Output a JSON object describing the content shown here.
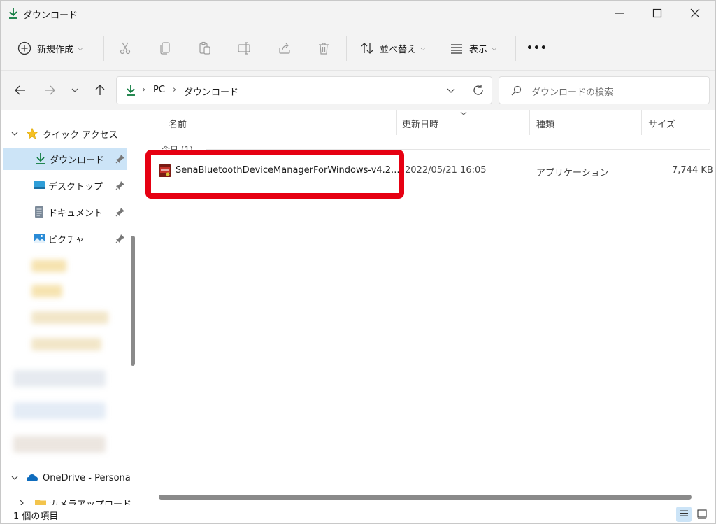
{
  "window": {
    "title": "ダウンロード"
  },
  "toolbar": {
    "new_label": "新規作成",
    "sort_label": "並べ替え",
    "view_label": "表示",
    "more_label": "•••"
  },
  "address": {
    "crumbs": [
      "PC",
      "ダウンロード"
    ],
    "search_placeholder": "ダウンロードの検索"
  },
  "sidebar": {
    "quick_access": "クイック アクセス",
    "items": [
      {
        "label": "ダウンロード",
        "icon": "download-icon",
        "pinned": true,
        "selected": true
      },
      {
        "label": "デスクトップ",
        "icon": "desktop-icon",
        "pinned": true
      },
      {
        "label": "ドキュメント",
        "icon": "document-icon",
        "pinned": true
      },
      {
        "label": "ピクチャ",
        "icon": "pictures-icon",
        "pinned": true
      }
    ],
    "onedrive": "OneDrive - Persona",
    "onedrive_child": "カメラアップロード"
  },
  "columns": {
    "name": "名前",
    "modified": "更新日時",
    "type": "種類",
    "size": "サイズ"
  },
  "group": {
    "label": "今日 (1)"
  },
  "files": [
    {
      "name": "SenaBluetoothDeviceManagerForWindows-v4.2...",
      "modified": "2022/05/21 16:05",
      "type": "アプリケーション",
      "size": "7,744 KB",
      "icon": "application-icon"
    }
  ],
  "status": {
    "count": "1 個の項目"
  },
  "colors": {
    "highlight": "#e60012",
    "selection": "#cce4f7",
    "accent": "#0f7b3f"
  }
}
